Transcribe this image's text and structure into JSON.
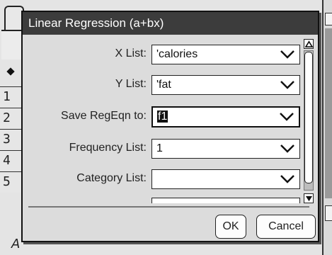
{
  "dialog": {
    "title": "Linear Regression (a+bx)",
    "fields": [
      {
        "label": "X List:",
        "value": "'calories"
      },
      {
        "label": "Y List:",
        "value": "'fat"
      },
      {
        "label": "Save RegEqn to:",
        "value": "f1"
      },
      {
        "label": "Frequency List:",
        "value": "1"
      },
      {
        "label": "Category List:",
        "value": ""
      }
    ],
    "ok_label": "OK",
    "cancel_label": "Cancel"
  },
  "background": {
    "row_numbers": [
      "1",
      "2",
      "3",
      "4",
      "5"
    ],
    "bottom_cell": "A"
  },
  "icons": {
    "dropdown": "chevron-down-icon",
    "scroll_up": "triangle-up-icon",
    "scroll_down": "triangle-down-icon"
  },
  "colors": {
    "titlebar": "#3c3c3c",
    "dialog_bg": "#dcdcdc"
  }
}
